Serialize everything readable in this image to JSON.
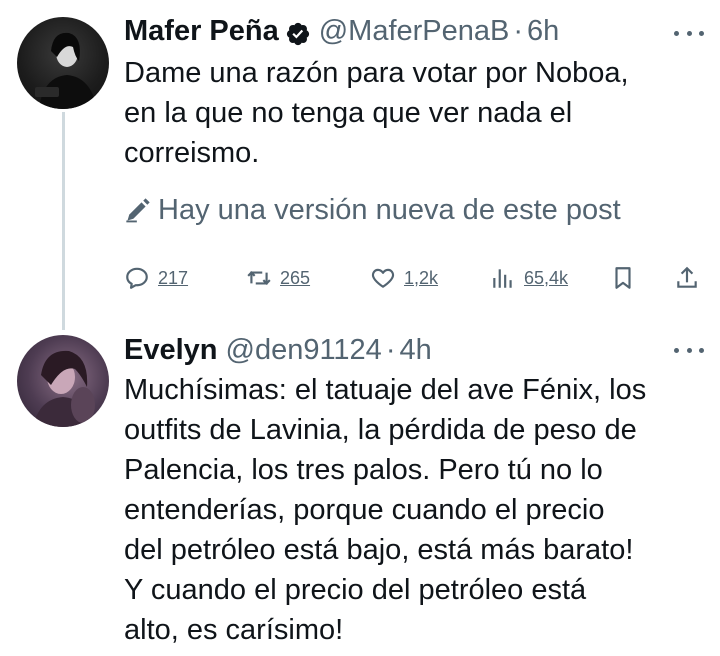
{
  "tweet1": {
    "name": "Mafer Peña",
    "handle": "@MaferPenaB",
    "separator": "·",
    "time": "6h",
    "text_lines": [
      "Dame una razón para votar por Noboa,",
      "en la que no tenga que ver nada el",
      "correismo."
    ],
    "edit_note": "Hay una versión nueva de este post",
    "stats": {
      "replies": "217",
      "reposts": "265",
      "likes": "1,2k",
      "views": "65,4k"
    },
    "avatar_icon": "avatar-photo",
    "verified_icon": "verified-badge-icon",
    "verified_color": "#1d9bf0"
  },
  "tweet2": {
    "name": "Evelyn",
    "handle": "@den91124",
    "separator": "·",
    "time": "4h",
    "text_lines": [
      "Muchísimas: el tatuaje del ave Fénix, los",
      "outfits de Lavinia, la pérdida de peso de",
      "Palencia, los tres palos. Pero tú no lo",
      "entenderías, porque cuando el precio",
      "del petróleo está bajo, está más barato!",
      "Y cuando el precio del petróleo está",
      "alto, es carísimo!"
    ],
    "avatar_icon": "avatar-photo"
  },
  "colors": {
    "text": "#0f1419",
    "secondary": "#536471",
    "thread_line": "#cfd9de"
  }
}
